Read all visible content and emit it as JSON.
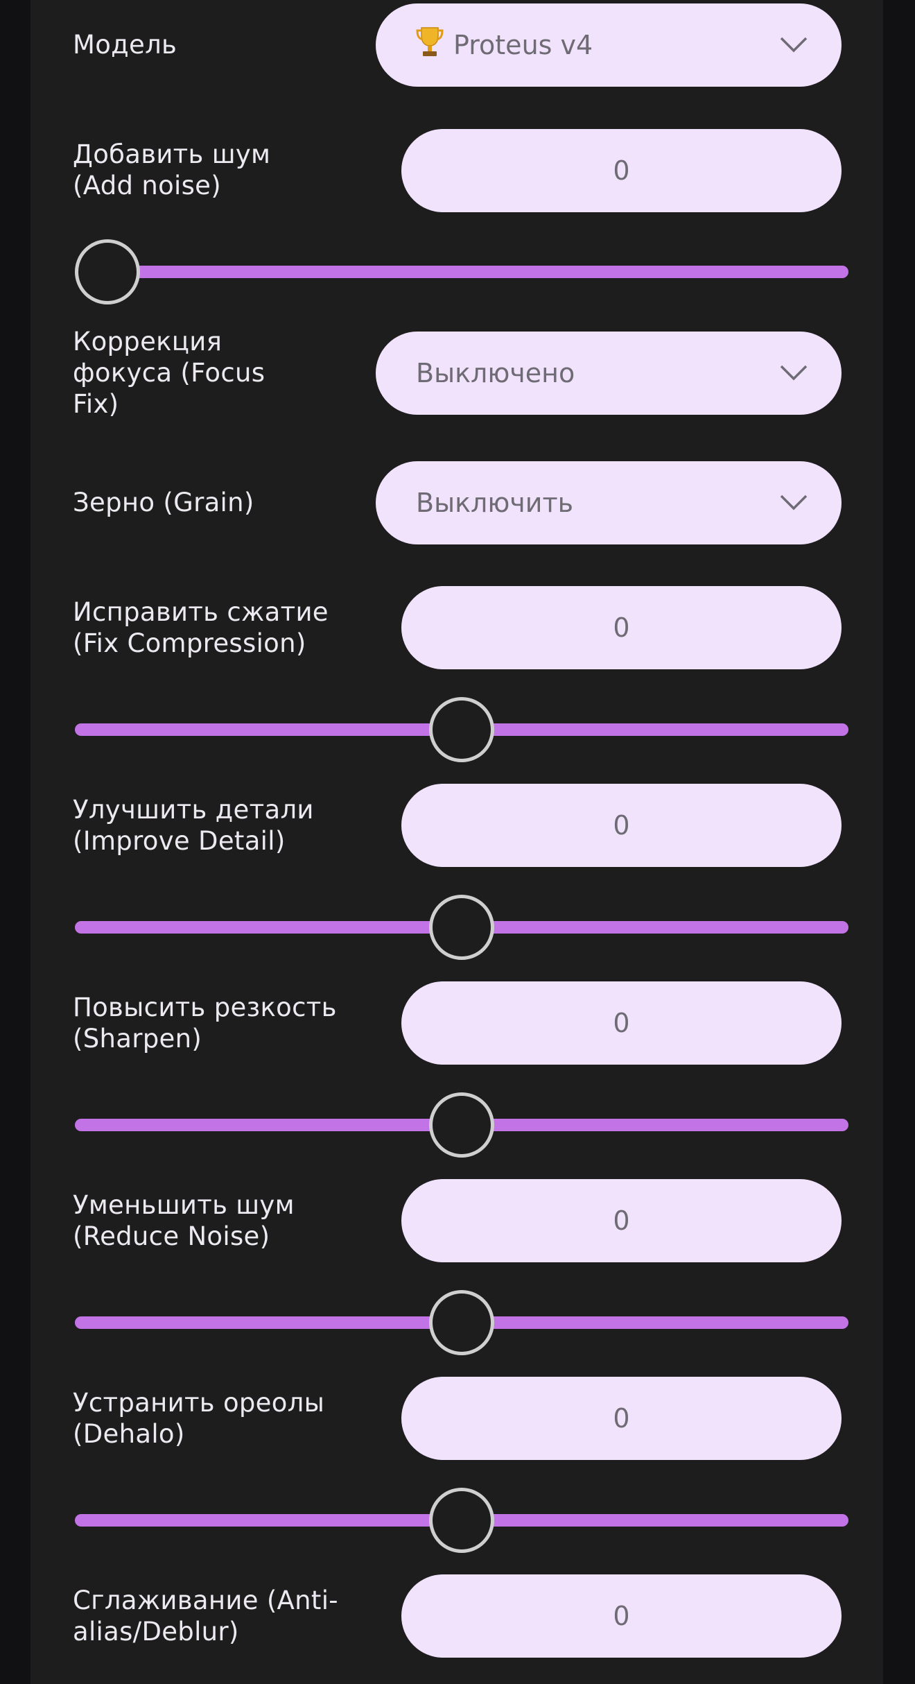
{
  "model": {
    "label": "Модель",
    "selected": "Proteus v4",
    "icon": "trophy-icon"
  },
  "add_noise": {
    "label_lines": [
      "Добавить шум",
      "(Add noise)"
    ],
    "value": "0",
    "slider_fraction": 0.0
  },
  "focus_fix": {
    "label_lines": [
      "Коррекция",
      "фокуса (Focus",
      "Fix)"
    ],
    "selected": "Выключено"
  },
  "grain": {
    "label_lines": [
      "Зерно (Grain)"
    ],
    "selected": "Выключить"
  },
  "fix_compression": {
    "label_lines": [
      "Исправить сжатие",
      "(Fix Compression)"
    ],
    "value": "0",
    "slider_fraction": 0.5
  },
  "improve_detail": {
    "label_lines": [
      "Улучшить детали",
      "(Improve Detail)"
    ],
    "value": "0",
    "slider_fraction": 0.5
  },
  "sharpen": {
    "label_lines": [
      "Повысить резкость",
      "(Sharpen)"
    ],
    "value": "0",
    "slider_fraction": 0.5
  },
  "reduce_noise": {
    "label_lines": [
      "Уменьшить шум",
      "(Reduce Noise)"
    ],
    "value": "0",
    "slider_fraction": 0.5
  },
  "dehalo": {
    "label_lines": [
      "Устранить ореолы",
      "(Dehalo)"
    ],
    "value": "0",
    "slider_fraction": 0.5
  },
  "anti_alias": {
    "label_lines": [
      "Сглаживание (Anti-",
      "alias/Deblur)"
    ],
    "value": "0"
  },
  "colors": {
    "panel": "#1d1d1e",
    "pill": "#f2e3fd",
    "track": "#c274e6",
    "thumb_border": "#cfcfcf"
  }
}
